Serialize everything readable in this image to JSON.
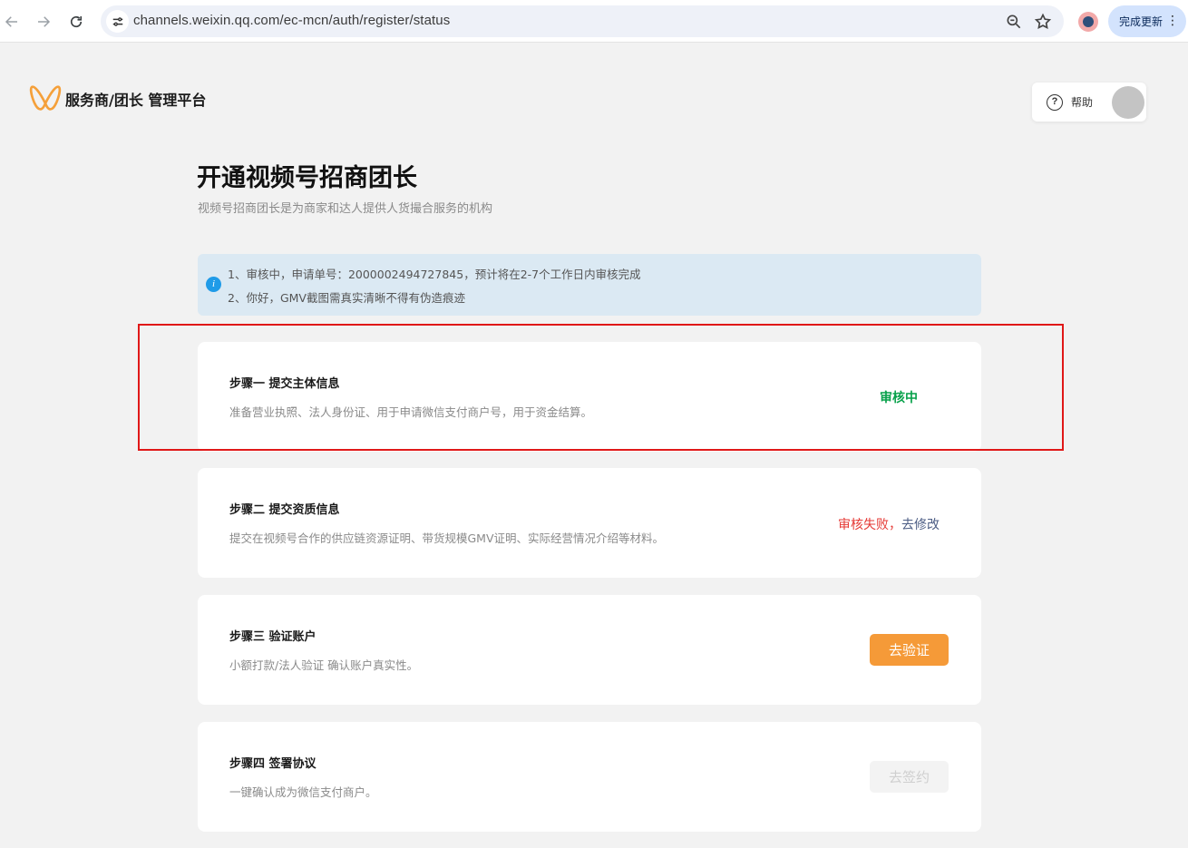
{
  "browser": {
    "url": "channels.weixin.qq.com/ec-mcn/auth/register/status",
    "update_label": "完成更新",
    "menu_glyph": "⋮",
    "icons": [
      "back-arrow-icon",
      "forward-arrow-icon",
      "reload-icon",
      "site-info-icon",
      "zoom-icon",
      "bookmark-star-icon",
      "profile-avatar-icon",
      "kebab-menu-icon"
    ]
  },
  "header": {
    "brand": "服务商/团长 管理平台",
    "help_label": "帮助",
    "help_glyph": "?"
  },
  "page": {
    "title": "开通视频号招商团长",
    "subtitle": "视频号招商团长是为商家和达人提供人货撮合服务的机构"
  },
  "notice": {
    "icon_glyph": "i",
    "lines": [
      "1、审核中，申请单号：2000002494727845，预计将在2-7个工作日内审核完成",
      "2、你好，GMV截图需真实清晰不得有伪造痕迹"
    ]
  },
  "steps": [
    {
      "title": "步骤一 提交主体信息",
      "desc": "准备营业执照、法人身份证、用于申请微信支付商户号，用于资金结算。",
      "status": "审核中"
    },
    {
      "title": "步骤二 提交资质信息",
      "desc": "提交在视频号合作的供应链资源证明、带货规模GMV证明、实际经营情况介绍等材料。",
      "status_fail": "审核失败，",
      "action_link": "去修改"
    },
    {
      "title": "步骤三 验证账户",
      "desc": "小额打款/法人验证 确认账户真实性。",
      "button": "去验证"
    },
    {
      "title": "步骤四 签署协议",
      "desc": "一键确认成为微信支付商户。",
      "button": "去签约"
    }
  ],
  "colors": {
    "brand_orange": "#f59a38",
    "status_green": "#07a14a",
    "status_red": "#e53935",
    "link_blue": "#4c5d84",
    "notice_bg": "#dbe9f3",
    "highlight_red": "#e01818"
  }
}
